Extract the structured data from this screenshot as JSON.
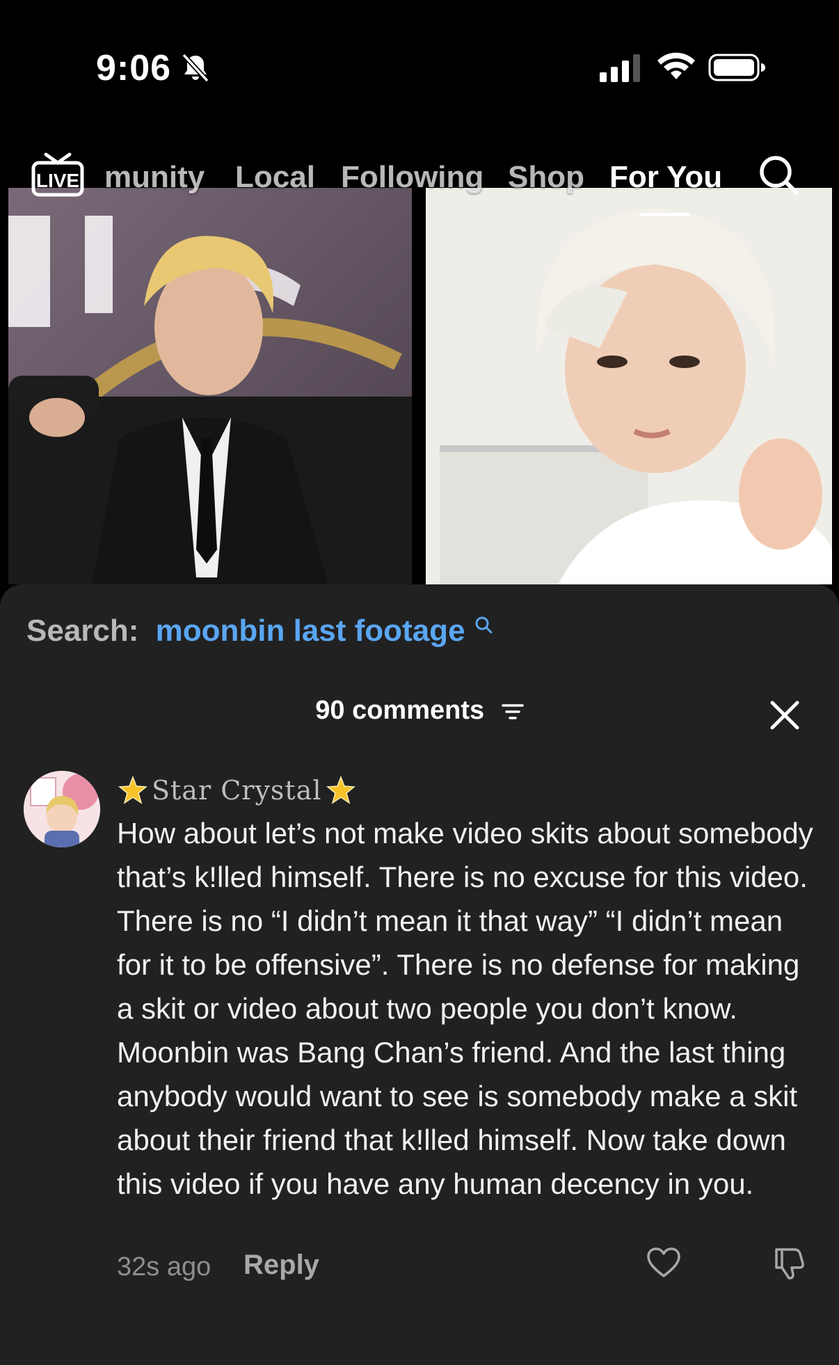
{
  "status_bar": {
    "time": "9:06"
  },
  "top_nav": {
    "live_label": "LIVE",
    "tabs": [
      "munity",
      "Local",
      "Following",
      "Shop",
      "For You"
    ],
    "active_tab": "For You"
  },
  "sheet": {
    "search_prefix": "Search:",
    "search_term": "moonbin last footage",
    "comments_count": "90 comments"
  },
  "comment": {
    "username": "Star Crystal",
    "text": "How about let’s not make video skits about somebody that’s k!lled himself. There is no excuse for this video. There is no “I didn’t mean it that way” “I didn’t mean for it to be offensive”. There is no defense for making a skit or video about two people you don’t know. Moonbin was Bang Chan’s friend. And the last thing anybody would want to see is somebody make a skit about their friend that k!lled himself. Now take down this video if you have any human decency in you.",
    "time_ago": "32s ago",
    "reply_label": "Reply"
  },
  "colors": {
    "sheet_bg": "#212121",
    "link_blue": "#5aa6f2"
  }
}
